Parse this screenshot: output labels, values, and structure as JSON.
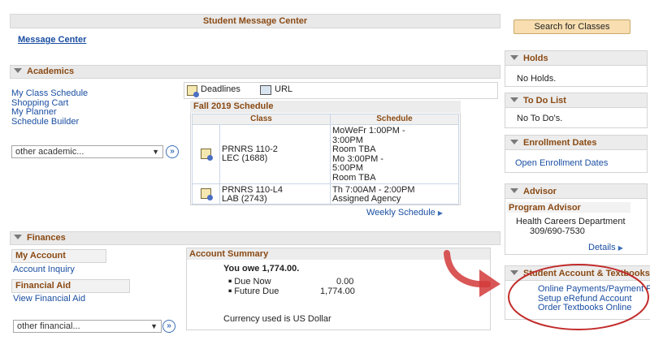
{
  "message_center": {
    "header": "Student Message Center",
    "link": "Message Center"
  },
  "academics": {
    "header": "Academics",
    "links": [
      "My Class Schedule",
      "Shopping Cart",
      "My Planner",
      "Schedule Builder"
    ],
    "select_value": "other academic...",
    "tabs": {
      "deadlines": "Deadlines",
      "url": "URL"
    },
    "schedule": {
      "title": "Fall 2019 Schedule",
      "col_class": "Class",
      "col_schedule": "Schedule",
      "rows": [
        {
          "class_lines": [
            "PRNRS 110-2",
            "LEC (1688)"
          ],
          "schedule_lines": [
            "MoWeFr 1:00PM -",
            "3:00PM",
            "Room  TBA",
            "Mo 3:00PM -",
            "5:00PM",
            "Room  TBA"
          ]
        },
        {
          "class_lines": [
            "PRNRS 110-L4",
            "LAB (2743)"
          ],
          "schedule_lines": [
            "Th 7:00AM - 2:00PM",
            "Assigned Agency"
          ]
        }
      ],
      "weekly_link": "Weekly Schedule"
    }
  },
  "finances": {
    "header": "Finances",
    "my_account": "My Account",
    "account_inquiry": "Account Inquiry",
    "financial_aid": "Financial Aid",
    "view_financial_aid": "View Financial Aid",
    "select_value": "other financial...",
    "summary": {
      "title": "Account Summary",
      "owe": "You owe 1,774.00.",
      "due_now_label": "Due Now",
      "due_now_value": "0.00",
      "future_due_label": "Future Due",
      "future_due_value": "1,774.00",
      "currency_note": "Currency used is US Dollar"
    }
  },
  "right": {
    "search_button": "Search for Classes",
    "holds": {
      "header": "Holds",
      "body": "No Holds."
    },
    "todo": {
      "header": "To Do List",
      "body": "No To Do's."
    },
    "enrollment": {
      "header": "Enrollment Dates",
      "link": "Open Enrollment Dates"
    },
    "advisor": {
      "header": "Advisor",
      "title": "Program Advisor",
      "dept": "Health Careers Department",
      "phone": "309/690-7530",
      "details": "Details"
    },
    "student_account": {
      "header": "Student Account & Textbooks",
      "links": [
        "Online Payments/Payment Plans",
        "Setup eRefund Account",
        "Order Textbooks Online"
      ]
    }
  },
  "colors": {
    "header_brown": "#8a4a14",
    "link_blue": "#1a4ea1",
    "annotation_red": "#d23a3a"
  }
}
